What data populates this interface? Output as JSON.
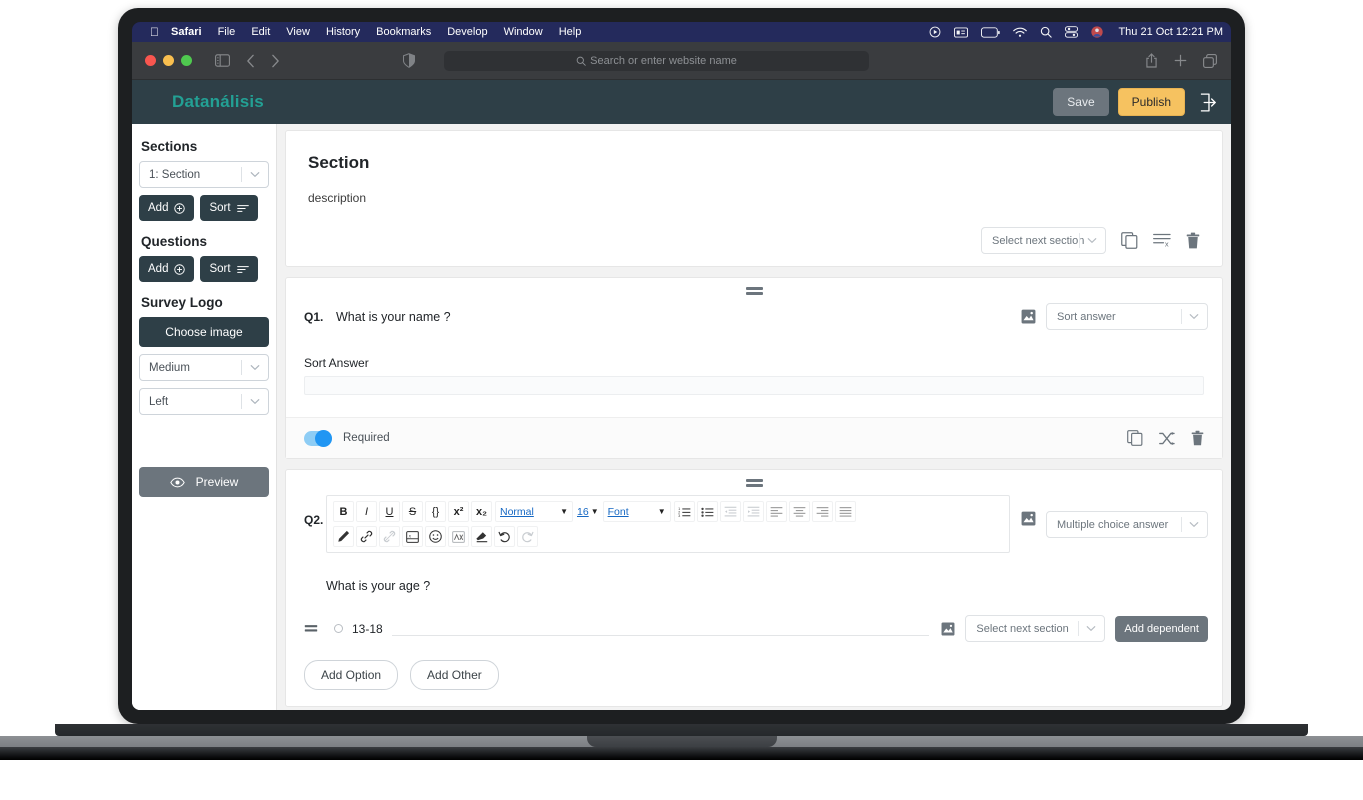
{
  "os": {
    "menubar": {
      "apple_icon": "apple-icon",
      "items": [
        {
          "label": "Safari",
          "bold": true
        },
        {
          "label": "File",
          "bold": false
        },
        {
          "label": "Edit",
          "bold": false
        },
        {
          "label": "View",
          "bold": false
        },
        {
          "label": "History",
          "bold": false
        },
        {
          "label": "Bookmarks",
          "bold": false
        },
        {
          "label": "Develop",
          "bold": false
        },
        {
          "label": "Window",
          "bold": false
        },
        {
          "label": "Help",
          "bold": false
        }
      ],
      "status_icons": [
        "screen-record-icon",
        "battery-widget-icon",
        "battery-icon",
        "wifi-icon",
        "search-icon",
        "control-center-icon",
        "user-avatar-icon"
      ],
      "clock": "Thu 21 Oct  12:21 PM"
    },
    "browser": {
      "traffic_lights": [
        "close-button",
        "minimize-button",
        "maximize-button"
      ],
      "sidebar_icon": "sidebar-toggle-icon",
      "back_icon": "back-icon",
      "forward_icon": "forward-icon",
      "shield_icon": "privacy-shield-icon",
      "address_placeholder": "Search or enter website name",
      "address_search_icon": "search-icon",
      "share_icon": "share-icon",
      "new_tab_icon": "plus-icon",
      "tabs_icon": "tab-overview-icon"
    }
  },
  "app": {
    "header": {
      "logo": "Datanálisis",
      "logo_color": "#23a094",
      "header_bg": "#2e3f47",
      "save_label": "Save",
      "publish_label": "Publish",
      "publish_color": "#f6c260",
      "logout_icon": "logout-icon"
    },
    "sidebar": {
      "sections_heading": "Sections",
      "section_select_value": "1: Section",
      "sections_add_label": "Add",
      "sections_sort_label": "Sort",
      "questions_heading": "Questions",
      "questions_add_label": "Add",
      "questions_sort_label": "Sort",
      "logo_heading": "Survey Logo",
      "choose_image_label": "Choose image",
      "size_select_value": "Medium",
      "align_select_value": "Left",
      "preview_label": "Preview",
      "preview_icon": "eye-icon"
    },
    "section_card": {
      "title": "Section",
      "description": "description",
      "next_section_value": "Select next section",
      "duplicate_icon": "duplicate-icon",
      "clear_icon": "clear-list-icon",
      "delete_icon": "trash-icon"
    },
    "questions": [
      {
        "number": "Q1.",
        "text": "What is your name ?",
        "image_icon": "image-icon",
        "answer_type": "Sort answer",
        "answer_label": "Sort Answer",
        "answer_value": "",
        "required_label": "Required",
        "required_on": true,
        "footer_icons": [
          "duplicate-icon",
          "shuffle-icon",
          "trash-icon"
        ]
      },
      {
        "number": "Q2.",
        "text": "What is your age ?",
        "image_icon": "image-icon",
        "answer_type": "Multiple choice answer",
        "options": [
          {
            "label": "13-18",
            "drag_icon": "drag-handle-icon",
            "image_icon": "image-icon",
            "next_section_value": "Select next section",
            "add_dependent_label": "Add dependent"
          }
        ],
        "add_option_label": "Add Option",
        "add_other_label": "Add Other"
      }
    ],
    "editor_toolbar": {
      "row1": [
        {
          "name": "bold",
          "glyph": "B",
          "style": "bold"
        },
        {
          "name": "italic",
          "glyph": "I",
          "style": "italic"
        },
        {
          "name": "underline",
          "glyph": "U",
          "style": "underline"
        },
        {
          "name": "strike",
          "glyph": "S",
          "style": "strike"
        },
        {
          "name": "code-block",
          "glyph": "{}",
          "style": "plain"
        },
        {
          "name": "superscript",
          "glyph": "x²",
          "style": "plain"
        },
        {
          "name": "subscript",
          "glyph": "x₂",
          "style": "plain"
        }
      ],
      "heading_value": "Normal",
      "size_value": "16",
      "font_value": "Font",
      "row1_lists": [
        "ordered-list-icon",
        "bullet-list-icon",
        "outdent-icon",
        "indent-icon",
        "align-left-icon",
        "align-center-icon",
        "align-right-icon",
        "align-justify-icon"
      ],
      "row2": [
        "pen-color-icon",
        "link-icon",
        "unlink-icon",
        "video-icon",
        "emoji-icon",
        "formula-icon",
        "eraser-icon",
        "undo-icon",
        "redo-icon"
      ]
    },
    "drag_handle_icon": "drag-handle-icon"
  }
}
